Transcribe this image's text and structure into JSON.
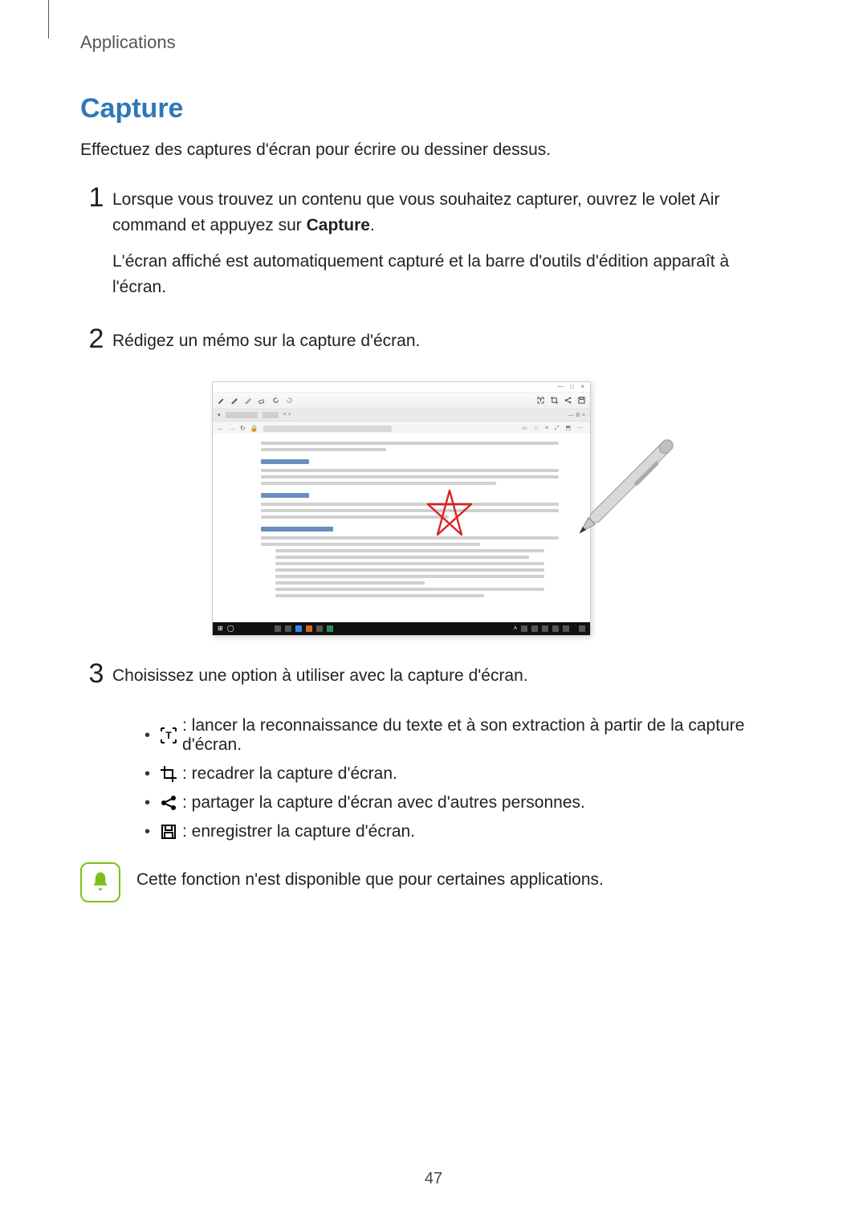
{
  "breadcrumb": "Applications",
  "title": "Capture",
  "intro": "Effectuez des captures d'écran pour écrire ou dessiner dessus.",
  "steps": {
    "1": {
      "p1_pre": "Lorsque vous trouvez un contenu que vous souhaitez capturer, ouvrez le volet Air command et appuyez sur ",
      "p1_bold": "Capture",
      "p1_post": ".",
      "p2": "L'écran affiché est automatiquement capturé et la barre d'outils d'édition apparaît à l'écran."
    },
    "2": "Rédigez un mémo sur la capture d'écran.",
    "3": {
      "lead": "Choisissez une option à utiliser avec la capture d'écran.",
      "opts": [
        " : lancer la reconnaissance du texte et à son extraction à partir de la capture d'écran.",
        " : recadrer la capture d'écran.",
        " : partager la capture d'écran avec d'autres personnes.",
        " : enregistrer la capture d'écran."
      ]
    }
  },
  "note": "Cette fonction n'est disponible que pour certaines applications.",
  "page_number": "47"
}
